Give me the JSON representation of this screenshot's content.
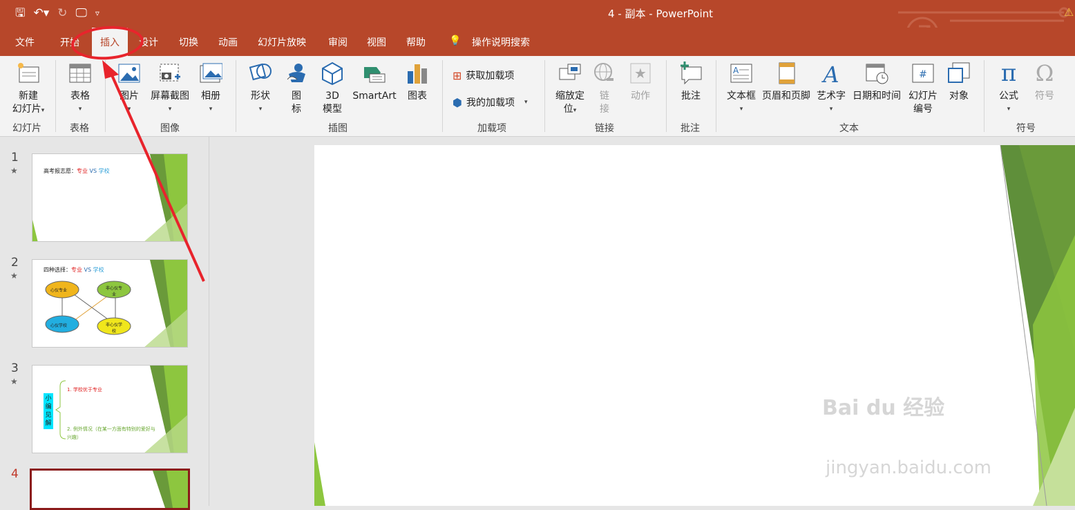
{
  "titlebar": {
    "title": "4 - 副本  -  PowerPoint",
    "qat": [
      "save-icon",
      "undo-icon",
      "redo-icon",
      "present-icon",
      "customize-icon"
    ]
  },
  "menu": {
    "tabs": [
      {
        "label": "文件"
      },
      {
        "label": "开始"
      },
      {
        "label": "插入",
        "active": true
      },
      {
        "label": "设计"
      },
      {
        "label": "切换"
      },
      {
        "label": "动画"
      },
      {
        "label": "幻灯片放映"
      },
      {
        "label": "审阅"
      },
      {
        "label": "视图"
      },
      {
        "label": "帮助"
      }
    ],
    "search": "操作说明搜索"
  },
  "ribbon": {
    "groups": [
      {
        "name": "幻灯片"
      },
      {
        "name": "表格"
      },
      {
        "name": "图像"
      },
      {
        "name": "插图"
      },
      {
        "name": "加载项"
      },
      {
        "name": "链接"
      },
      {
        "name": "批注"
      },
      {
        "name": "文本"
      },
      {
        "name": "符号"
      }
    ],
    "buttons": {
      "new_slide": [
        "新建",
        "幻灯片"
      ],
      "table": "表格",
      "picture": "图片",
      "screenshot": "屏幕截图",
      "album": "相册",
      "shapes": "形状",
      "icons": [
        "图",
        "标"
      ],
      "model3d": [
        "3D",
        "模型"
      ],
      "smartart": "SmartArt",
      "chart": "图表",
      "get_addins": "获取加载项",
      "my_addins": "我的加载项",
      "zoom": [
        "缩放定",
        "位"
      ],
      "link": [
        "链",
        "接"
      ],
      "action": "动作",
      "comment": "批注",
      "textbox": "文本框",
      "header_footer": "页眉和页脚",
      "wordart": "艺术字",
      "datetime": "日期和时间",
      "slide_number": [
        "幻灯片",
        "编号"
      ],
      "object": "对象",
      "equation": "公式",
      "symbol": "符号"
    }
  },
  "slides": [
    {
      "num": "1",
      "title_black": "高考报志愿：",
      "title_red": "专业",
      "title_vs": " VS ",
      "title_blue": "学校"
    },
    {
      "num": "2",
      "title_black": "四种选择：",
      "title_red": "专业",
      "title_vs": " VS ",
      "title_blue": "学校",
      "nodes": [
        "心仪专业",
        "非心仪专业",
        "心仪学校",
        "非心仪学校"
      ]
    },
    {
      "num": "3",
      "side": "小编见解",
      "point1": "1. 学校优于专业",
      "point2": "2. 例外情况（在某一方面有特别的爱好与兴趣）"
    },
    {
      "num": "4"
    }
  ],
  "watermark": {
    "brand": "Bai  du 经验",
    "url": "jingyan.baidu.com"
  },
  "colors": {
    "brand": "#b7472a",
    "green": "#8dc63f",
    "annotation": "#e8242c"
  }
}
